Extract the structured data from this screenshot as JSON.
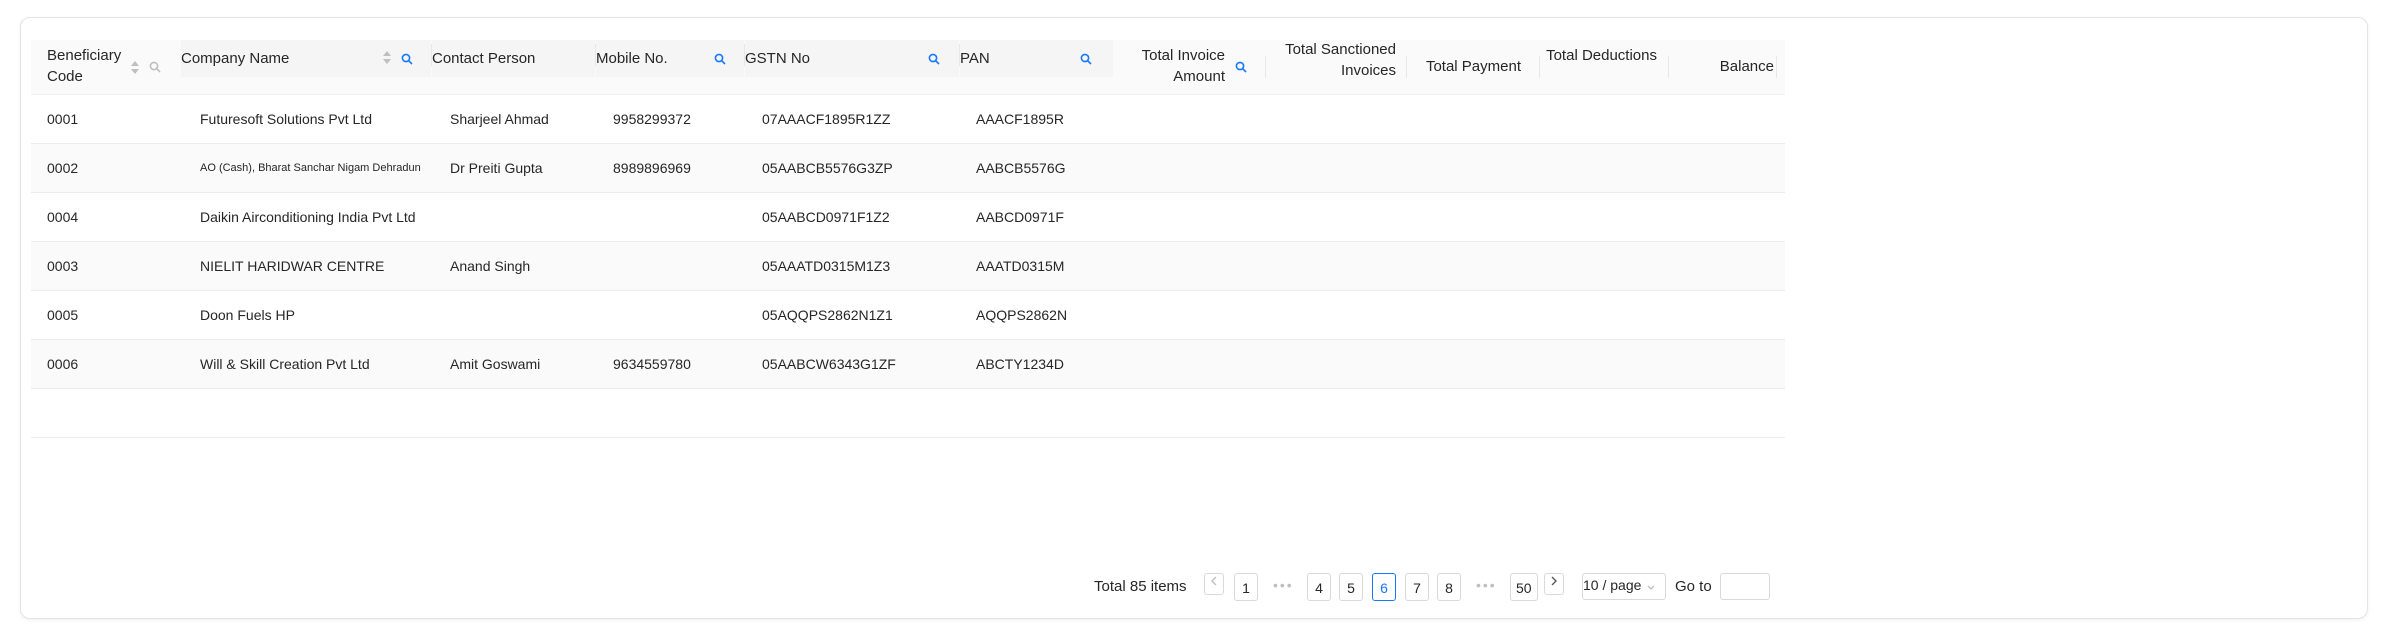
{
  "columns": {
    "beneficiary_code": "Beneficiary Code",
    "company_name": "Company Name",
    "contact_person": "Contact Person",
    "mobile_no": "Mobile No.",
    "gstn_no": "GSTN No",
    "pan": "PAN",
    "total_invoice_amount": "Total Invoice Amount",
    "total_sanctioned_invoices": "Total Sanctioned Invoices",
    "total_payment": "Total Payment",
    "total_deductions": "Total Deductions",
    "balance": "Balance"
  },
  "rows": [
    {
      "code": "0001",
      "company": "Futuresoft  Solutions Pvt Ltd",
      "contact": "Sharjeel Ahmad",
      "mobile": "9958299372",
      "gstn": "07AAACF1895R1ZZ",
      "pan": "AAACF1895R"
    },
    {
      "code": "0002",
      "company": "AO (Cash), Bharat Sanchar Nigam Dehradun",
      "contact": "Dr Preiti Gupta",
      "mobile": "8989896969",
      "gstn": "05AABCB5576G3ZP",
      "pan": "AABCB5576G"
    },
    {
      "code": "0004",
      "company": "Daikin Airconditioning India Pvt Ltd",
      "contact": "",
      "mobile": "",
      "gstn": "05AABCD0971F1Z2",
      "pan": "AABCD0971F"
    },
    {
      "code": "0003",
      "company": "NIELIT HARIDWAR CENTRE",
      "contact": "Anand Singh",
      "mobile": "",
      "gstn": "05AAATD0315M1Z3",
      "pan": "AAATD0315M"
    },
    {
      "code": "0005",
      "company": "Doon Fuels HP",
      "contact": "",
      "mobile": "",
      "gstn": "05AQQPS2862N1Z1",
      "pan": "AQQPS2862N"
    },
    {
      "code": "0006",
      "company": "Will & Skill Creation Pvt Ltd",
      "contact": "Amit Goswami",
      "mobile": "9634559780",
      "gstn": "05AABCW6343G1ZF",
      "pan": "ABCTY1234D"
    }
  ],
  "pagination": {
    "total": "Total 85 items",
    "pages": [
      "1",
      "4",
      "5",
      "6",
      "7",
      "8",
      "50"
    ],
    "current": "6",
    "ellipsis": "•••",
    "page_size": "10 / page",
    "goto_label": "Go to",
    "prev_icon": "chevron-left",
    "next_icon": "chevron-right"
  },
  "colors": {
    "accent": "#1677ff",
    "header_bg": "#fafafa",
    "border": "#f0f0f0"
  }
}
